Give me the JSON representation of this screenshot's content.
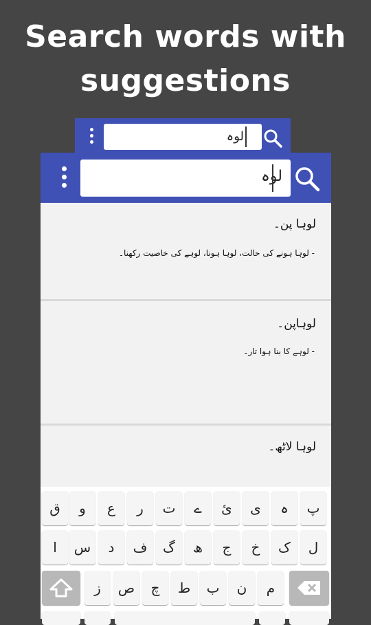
{
  "headline": {
    "line1": "Search words with",
    "line2": "suggestions"
  },
  "back_screen": {
    "search_query": "لوہ",
    "icons": {
      "menu": "more-vert-icon",
      "search": "search-icon"
    }
  },
  "front_screen": {
    "search_query": "لوہ",
    "icons": {
      "menu": "more-vert-icon",
      "search": "search-icon"
    },
    "results": [
      {
        "word": "لوہا پن۔",
        "meaning": "- لوہا ہونے کی حالت، لوہا ہونا، لوہے کی خاصیت رکھنا۔"
      },
      {
        "word": "لوہاپن۔",
        "meaning": "- لوہے کا بنا ہوا تار۔"
      },
      {
        "word": "لوہا لاٹھ۔",
        "meaning": ""
      }
    ]
  },
  "keyboard": {
    "row1": [
      "پ",
      "ہ",
      "ی",
      "ئ",
      "ے",
      "ت",
      "ر",
      "ع",
      "و",
      "ق"
    ],
    "row2": [
      "ل",
      "ک",
      "خ",
      "ج",
      "ھ",
      "گ",
      "ف",
      "د",
      "س",
      "ا"
    ],
    "row3": [
      "م",
      "ن",
      "ب",
      "ط",
      "چ",
      "ص",
      "ز"
    ],
    "icons": {
      "shift": "shift-icon",
      "backspace": "backspace-icon"
    }
  },
  "colors": {
    "background": "#454545",
    "toolbar": "#3f51b5",
    "list": "#f2f2f2",
    "key": "#f5f5f5"
  }
}
